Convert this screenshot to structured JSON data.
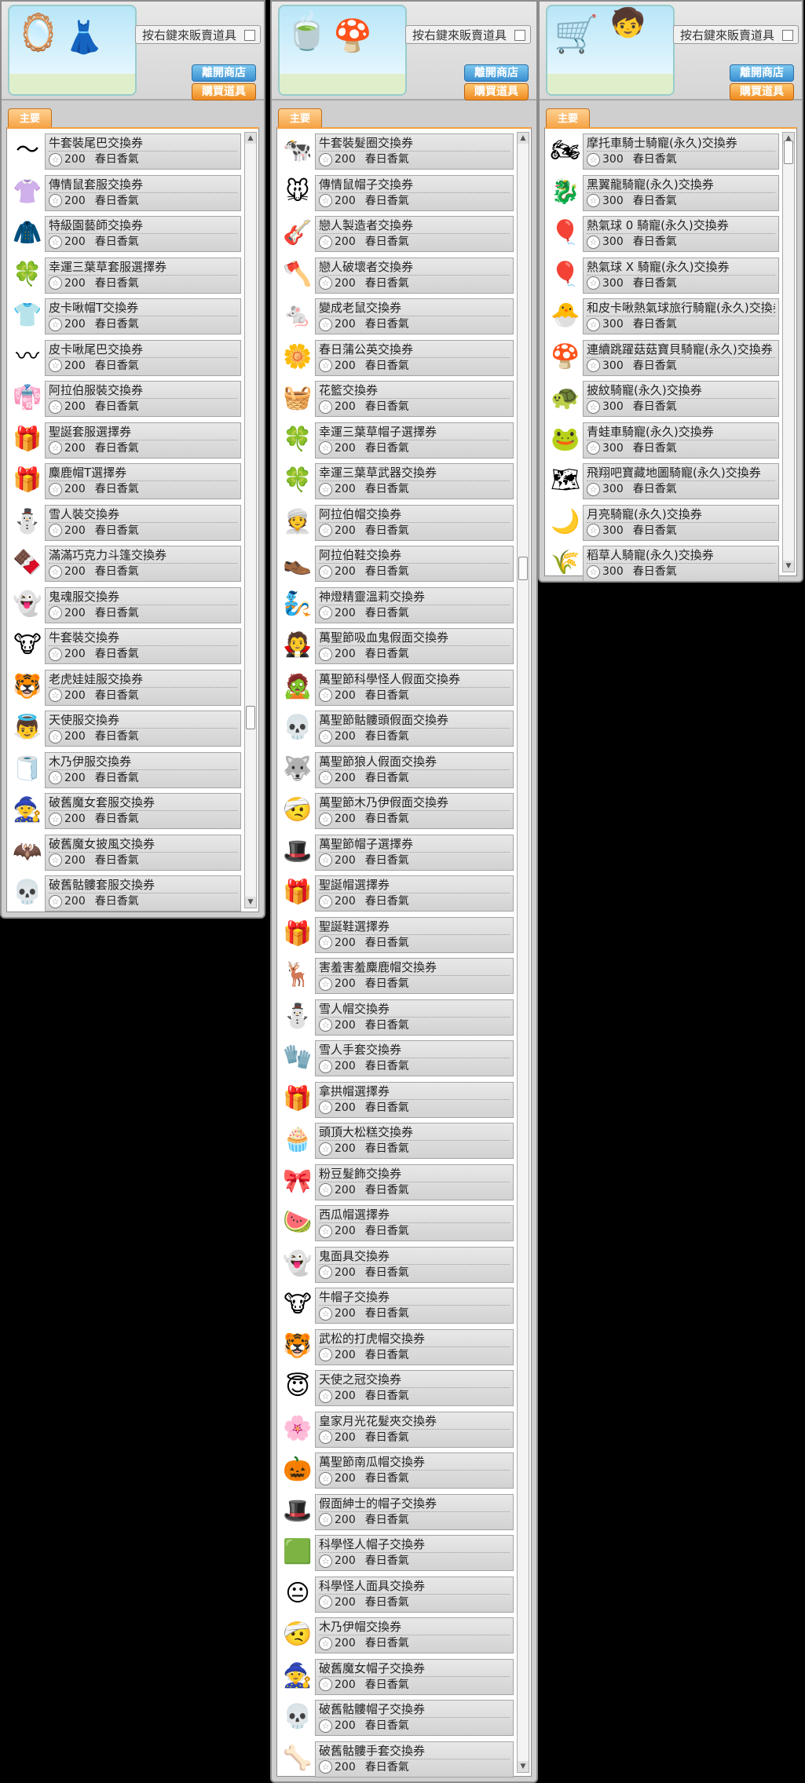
{
  "header": {
    "hint": "按右鍵來販賣道具",
    "exit_label": "離開商店",
    "buy_label": "購買道具",
    "tab_label": "主要",
    "currency": "春日香氣"
  },
  "panels": [
    {
      "price": "200",
      "items": [
        {
          "name": "牛套裝尾巴交換券",
          "icon": "〜"
        },
        {
          "name": "傳情鼠套服交換券",
          "icon": "👚"
        },
        {
          "name": "特級園藝師交換券",
          "icon": "🧥"
        },
        {
          "name": "幸運三葉草套服選擇券",
          "icon": "🍀"
        },
        {
          "name": "皮卡啾帽T交換券",
          "icon": "👕"
        },
        {
          "name": "皮卡啾尾巴交換券",
          "icon": "〰"
        },
        {
          "name": "阿拉伯服裝交換券",
          "icon": "👘"
        },
        {
          "name": "聖誕套服選擇券",
          "icon": "🎁"
        },
        {
          "name": "麋鹿帽T選擇券",
          "icon": "🎁"
        },
        {
          "name": "雪人裝交換券",
          "icon": "⛄"
        },
        {
          "name": "滿滿巧克力斗篷交換券",
          "icon": "🍫"
        },
        {
          "name": "鬼魂服交換券",
          "icon": "👻"
        },
        {
          "name": "牛套裝交換券",
          "icon": "🐮"
        },
        {
          "name": "老虎娃娃服交換券",
          "icon": "🐯"
        },
        {
          "name": "天使服交換券",
          "icon": "👼"
        },
        {
          "name": "木乃伊服交換券",
          "icon": "🧻"
        },
        {
          "name": "破舊魔女套服交換券",
          "icon": "🧙"
        },
        {
          "name": "破舊魔女披風交換券",
          "icon": "🦇"
        },
        {
          "name": "破舊骷髏套服交換券",
          "icon": "💀"
        }
      ]
    },
    {
      "price": "200",
      "items": [
        {
          "name": "牛套裝髮圈交換券",
          "icon": "🐄"
        },
        {
          "name": "傳情鼠帽子交換券",
          "icon": "🐭"
        },
        {
          "name": "戀人製造者交換券",
          "icon": "🎸"
        },
        {
          "name": "戀人破壞者交換券",
          "icon": "🪓"
        },
        {
          "name": "變成老鼠交換券",
          "icon": "🐁"
        },
        {
          "name": "春日蒲公英交換券",
          "icon": "🌼"
        },
        {
          "name": "花籃交換券",
          "icon": "🧺"
        },
        {
          "name": "幸運三葉草帽子選擇券",
          "icon": "🍀"
        },
        {
          "name": "幸運三葉草武器交換券",
          "icon": "🍀"
        },
        {
          "name": "阿拉伯帽交換券",
          "icon": "👳"
        },
        {
          "name": "阿拉伯鞋交換券",
          "icon": "👞"
        },
        {
          "name": "神燈精靈溫莉交換券",
          "icon": "🧞"
        },
        {
          "name": "萬聖節吸血鬼假面交換券",
          "icon": "🧛"
        },
        {
          "name": "萬聖節科學怪人假面交換券",
          "icon": "🧟"
        },
        {
          "name": "萬聖節骷髏頭假面交換券",
          "icon": "💀"
        },
        {
          "name": "萬聖節狼人假面交換券",
          "icon": "🐺"
        },
        {
          "name": "萬聖節木乃伊假面交換券",
          "icon": "🤕"
        },
        {
          "name": "萬聖節帽子選擇券",
          "icon": "🎩"
        },
        {
          "name": "聖誕帽選擇券",
          "icon": "🎁"
        },
        {
          "name": "聖誕鞋選擇券",
          "icon": "🎁"
        },
        {
          "name": "害羞害羞麋鹿帽交換券",
          "icon": "🦌"
        },
        {
          "name": "雪人帽交換券",
          "icon": "⛄"
        },
        {
          "name": "雪人手套交換券",
          "icon": "🧤"
        },
        {
          "name": "拿拱帽選擇券",
          "icon": "🎁"
        },
        {
          "name": "頭頂大松糕交換券",
          "icon": "🧁"
        },
        {
          "name": "粉豆髮飾交換券",
          "icon": "🎀"
        },
        {
          "name": "西瓜帽選擇券",
          "icon": "🍉"
        },
        {
          "name": "鬼面具交換券",
          "icon": "👻"
        },
        {
          "name": "牛帽子交換券",
          "icon": "🐮"
        },
        {
          "name": "武松的打虎帽交換券",
          "icon": "🐯"
        },
        {
          "name": "天使之冠交換券",
          "icon": "😇"
        },
        {
          "name": "皇家月光花髮夾交換券",
          "icon": "🌸"
        },
        {
          "name": "萬聖節南瓜帽交換券",
          "icon": "🎃"
        },
        {
          "name": "假面紳士的帽子交換券",
          "icon": "🎩"
        },
        {
          "name": "科學怪人帽子交換券",
          "icon": "🟩"
        },
        {
          "name": "科學怪人面具交換券",
          "icon": "😐"
        },
        {
          "name": "木乃伊帽交換券",
          "icon": "🤕"
        },
        {
          "name": "破舊魔女帽子交換券",
          "icon": "🧙"
        },
        {
          "name": "破舊骷髏帽子交換券",
          "icon": "💀"
        },
        {
          "name": "破舊骷髏手套交換券",
          "icon": "🦴"
        }
      ]
    },
    {
      "price": "300",
      "items": [
        {
          "name": "摩托車騎士騎寵(永久)交換券",
          "icon": "🏍"
        },
        {
          "name": "黑翼龍騎寵(永久)交換券",
          "icon": "🐉"
        },
        {
          "name": "熱氣球 0 騎寵(永久)交換券",
          "icon": "🎈"
        },
        {
          "name": "熱氣球 X 騎寵(永久)交換券",
          "icon": "🎈"
        },
        {
          "name": "和皮卡啾熱氣球旅行騎寵(永久)交換券",
          "icon": "🐣"
        },
        {
          "name": "連續跳躍菇菇寶貝騎寵(永久)交換券",
          "icon": "🍄"
        },
        {
          "name": "披紋騎寵(永久)交換券",
          "icon": "🐢"
        },
        {
          "name": "青蛙車騎寵(永久)交換券",
          "icon": "🐸"
        },
        {
          "name": "飛翔吧寶藏地圖騎寵(永久)交換券",
          "icon": "🗺"
        },
        {
          "name": "月亮騎寵(永久)交換券",
          "icon": "🌙"
        },
        {
          "name": "稻草人騎寵(永久)交換券",
          "icon": "🌾"
        }
      ]
    }
  ]
}
